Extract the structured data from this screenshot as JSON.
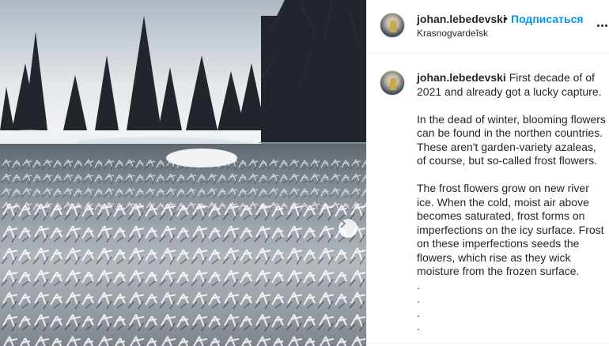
{
  "post": {
    "author": {
      "username": "johan.lebedevski",
      "location": "Krasnogvardeĭsk"
    },
    "separator": "•",
    "follow_label": "Подписаться",
    "more_icon": "more-horizontal-icon",
    "next_icon": "chevron-right-icon",
    "caption": {
      "username": "johan.lebedevski",
      "intro": "First decade of of 2021 and already got a lucky capture.",
      "paragraph_2": "In the dead of winter, blooming flowers can be found in the northen countries. These aren't garden-variety azaleas, of course, but so-called frost flowers.",
      "paragraph_3": "The frost flowers grow on new river ice. When the cold, moist air above becomes saturated, frost forms on imperfections on the icy surface. Frost on these imperfections seeds the flowers, which rise as they wick moisture from the frozen surface.",
      "dots": [
        ".",
        ".",
        ".",
        "."
      ]
    },
    "colors": {
      "follow": "#0095f6",
      "text": "#262626",
      "border": "#efefef"
    }
  }
}
